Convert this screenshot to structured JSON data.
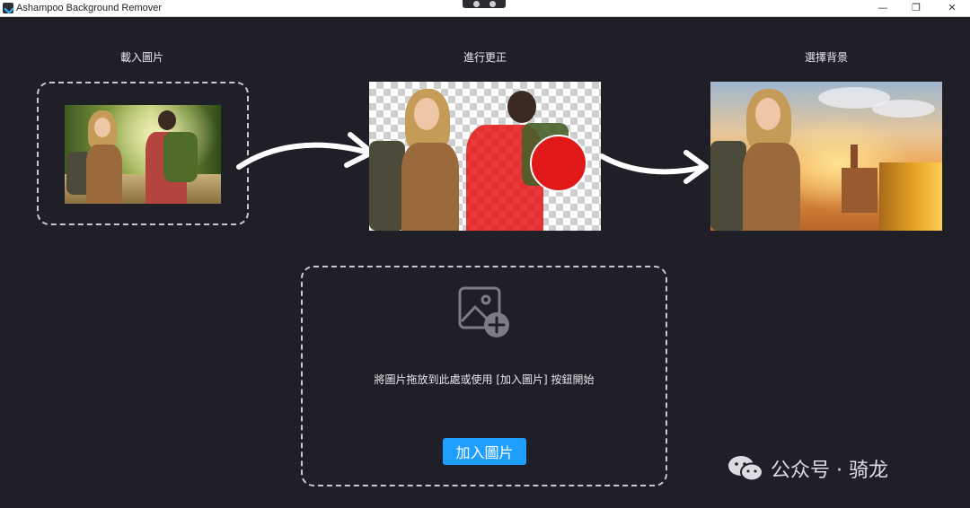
{
  "window": {
    "title": "Ashampoo Background Remover",
    "controls": {
      "minimize": "—",
      "restore": "❐",
      "close": "✕"
    }
  },
  "steps": [
    {
      "label": "載入圖片"
    },
    {
      "label": "進行更正"
    },
    {
      "label": "選擇背景"
    }
  ],
  "drop_zone": {
    "instruction": "將圖片拖放到此處或使用 [加入圖片] 按鈕開始",
    "button_label": "加入圖片"
  },
  "watermark": {
    "text": "公众号 · 骑龙"
  },
  "colors": {
    "background": "#1f1f27",
    "accent_button": "#1e9fff",
    "correction_red": "#e01818",
    "dashed_border": "#c9c9d1"
  }
}
